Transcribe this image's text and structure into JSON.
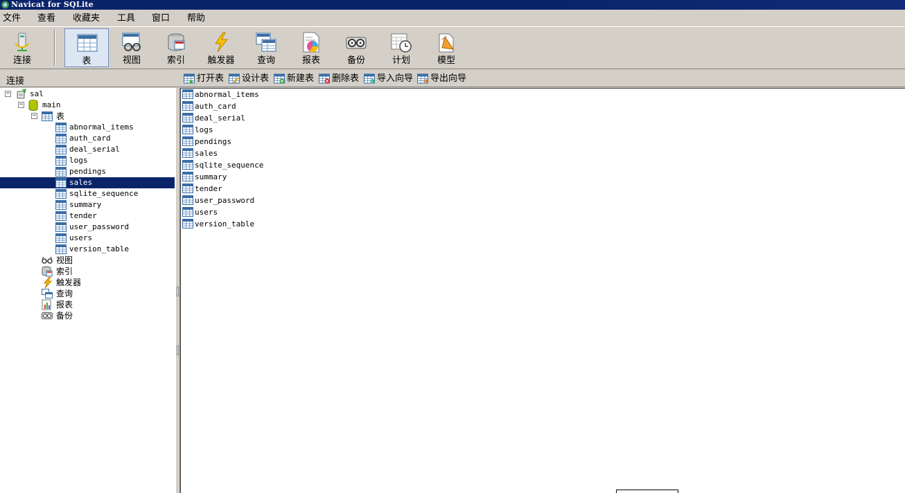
{
  "window": {
    "title": "Navicat for SQLite"
  },
  "menu": [
    "文件",
    "查看",
    "收藏夹",
    "工具",
    "窗口",
    "帮助"
  ],
  "toolbar": {
    "connect": "连接",
    "items": [
      "表",
      "视图",
      "索引",
      "触发器",
      "查询",
      "报表",
      "备份",
      "计划",
      "模型"
    ],
    "active": "表"
  },
  "subbar": {
    "connection_label": "连接",
    "actions": [
      "打开表",
      "设计表",
      "新建表",
      "删除表",
      "导入向导",
      "导出向导"
    ]
  },
  "tree": {
    "connection": "sal",
    "database": "main",
    "tables_node": "表",
    "tables": [
      "abnormal_items",
      "auth_card",
      "deal_serial",
      "logs",
      "pendings",
      "sales",
      "sqlite_sequence",
      "summary",
      "tender",
      "user_password",
      "users",
      "version_table"
    ],
    "selected_table": "sales",
    "other_nodes": [
      {
        "label": "视图",
        "icon": "view-icon"
      },
      {
        "label": "索引",
        "icon": "index-icon"
      },
      {
        "label": "触发器",
        "icon": "trigger-icon"
      },
      {
        "label": "查询",
        "icon": "query-icon"
      },
      {
        "label": "报表",
        "icon": "report-icon"
      },
      {
        "label": "备份",
        "icon": "backup-icon"
      }
    ]
  },
  "table_list": [
    "abnormal_items",
    "auth_card",
    "deal_serial",
    "logs",
    "pendings",
    "sales",
    "sqlite_sequence",
    "summary",
    "tender",
    "user_password",
    "users",
    "version_table"
  ],
  "colors": {
    "selection": "#0a246a",
    "title_bar": "#0a246a",
    "chrome": "#d4d0c8"
  }
}
